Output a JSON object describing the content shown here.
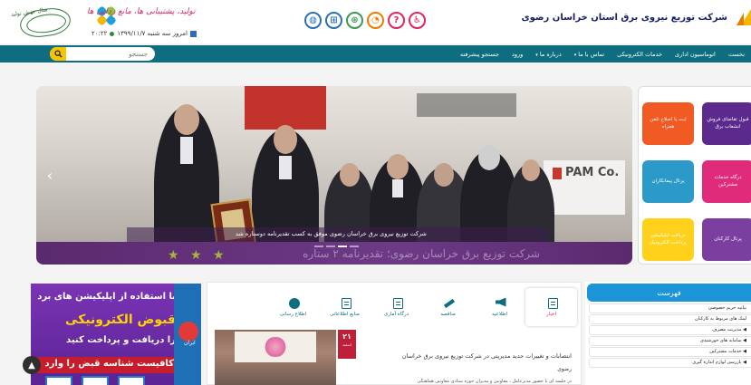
{
  "header": {
    "org_title": "شرکت توزیع نیروی برق استان خراسان رضوی",
    "campaign_text": "تولید، پشتیبانی ها، مانع زدایی ها",
    "date_text": "امروز سه شنبه ۱۳۹۹/۱۱/۷",
    "time_text": "۲۰:۲۲",
    "emblem_text": "سال جهش تولید",
    "icons": [
      "globe-icon",
      "sitemap-icon",
      "login-icon",
      "rss-icon",
      "help-icon",
      "accessibility-icon"
    ]
  },
  "nav": {
    "items": [
      "نخست",
      "اتوماسیون اداری",
      "خدمات الکترونیکی",
      "تماس با ما",
      "درباره ما",
      "ورود",
      "جستجو پیشرفته"
    ],
    "search_placeholder": "جستجو"
  },
  "slider": {
    "caption": "شرکت توزیع نیروی برق خراسان رضوی موفق به کسب تقدیرنامه دوستاره شد",
    "bottom_text": "شرکت توزیع برق خراسان رضوی؛ تقدیرنامه ۲ ستاره",
    "logo_text": "PAM Co.",
    "active_dot": 2
  },
  "tiles": [
    {
      "label": "قبول تقاضای فروش انشعاب برق",
      "color": "#5b2a8c"
    },
    {
      "label": "ثبت یا اصلاح تلفن همراه",
      "color": "#f15a22"
    },
    {
      "label": "درگاه خدمات مشترکین",
      "color": "#e02a7a"
    },
    {
      "label": "پرتال پیمانکاران",
      "color": "#2b9ac9"
    },
    {
      "label": "پرتال کارکنان",
      "color": "#7b3fa0"
    },
    {
      "label": "دریافت اپلیکیشن پرداخت الکترونیک",
      "color": "#ffd11a"
    }
  ],
  "promo": {
    "line1": "با استفاده از اپلیکیشن های برد",
    "line2": "قبوض الکترونیکی",
    "line3": "را دریافت و پرداخت کنید",
    "line4": "کافیست شناسه قبض را وارد",
    "side_text": "ایران"
  },
  "tabs": [
    {
      "label": "اخبار",
      "icon": "news-icon",
      "active": true
    },
    {
      "label": "اطلاعیه",
      "icon": "announcement-icon",
      "active": false
    },
    {
      "label": "مناقصه",
      "icon": "auction-icon",
      "active": false
    },
    {
      "label": "درگاه آماری",
      "icon": "statistics-icon",
      "active": false
    },
    {
      "label": "منابع اطلاعاتی",
      "icon": "resources-icon",
      "active": false
    },
    {
      "label": "اطلاع رسانی",
      "icon": "broadcast-icon",
      "active": false
    }
  ],
  "news": {
    "day": "۲۱",
    "month": "اسفند",
    "title": "انتصابات و تغییرات جدید مدیریتی در شرکت توزیع نیروی برق خراسان",
    "subtitle": "رضوی",
    "body": "در جلسه ای با حضور مدیرعامل ، معاونین و مدیران حوزه ستادی معاونین هماهنگی"
  },
  "list_panel": {
    "title": "فهرست",
    "items": [
      "بیانیه حریم خصوصی",
      "لینک های مربوط به کارکنان",
      "◀ مدیریت مصرف",
      "◀ سامانه های خورشیدی",
      "◀ خدمات مشترکین",
      "◀ بازرسی لوازم اندازه گیری"
    ]
  }
}
